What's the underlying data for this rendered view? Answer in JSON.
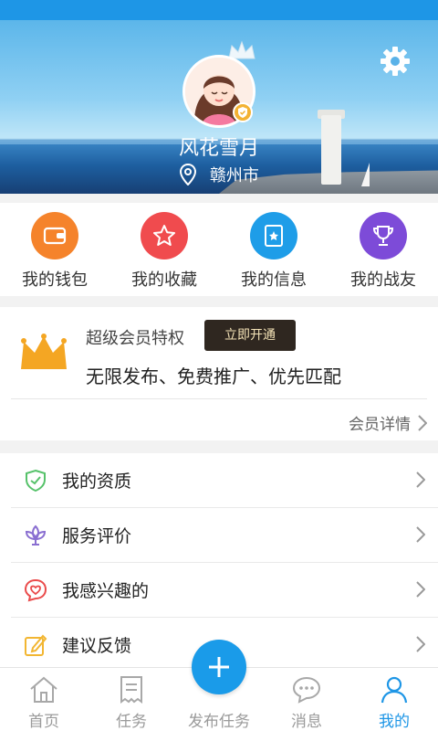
{
  "profile": {
    "username": "风花雪月",
    "city": "赣州市"
  },
  "quick_actions": [
    {
      "label": "我的钱包",
      "icon": "wallet-icon",
      "color": "#f5832b"
    },
    {
      "label": "我的收藏",
      "icon": "star-icon",
      "color": "#f04b4e"
    },
    {
      "label": "我的信息",
      "icon": "info-book-icon",
      "color": "#1e9de8"
    },
    {
      "label": "我的战友",
      "icon": "trophy-icon",
      "color": "#7d4bd8"
    }
  ],
  "vip": {
    "title": "超级会员特权",
    "button_label": "立即开通",
    "description": "无限发布、免费推广、优先匹配",
    "details_label": "会员详情"
  },
  "menu": [
    {
      "label": "我的资质",
      "icon": "shield-check-icon",
      "color": "#56c26a"
    },
    {
      "label": "服务评价",
      "icon": "lotus-icon",
      "color": "#8a6fd1"
    },
    {
      "label": "我感兴趣的",
      "icon": "heart-chat-icon",
      "color": "#ea4b4b"
    },
    {
      "label": "建议反馈",
      "icon": "edit-icon",
      "color": "#f2b632"
    }
  ],
  "tabbar": {
    "items": [
      {
        "label": "首页",
        "icon": "home-icon"
      },
      {
        "label": "任务",
        "icon": "task-list-icon"
      },
      {
        "label": "发布任务",
        "icon": "plus-icon"
      },
      {
        "label": "消息",
        "icon": "message-icon"
      },
      {
        "label": "我的",
        "icon": "user-icon",
        "active": true
      }
    ]
  },
  "colors": {
    "accent": "#1e96e6",
    "vip_gold": "#f4a623",
    "vip_button_bg": "#2f2720"
  }
}
